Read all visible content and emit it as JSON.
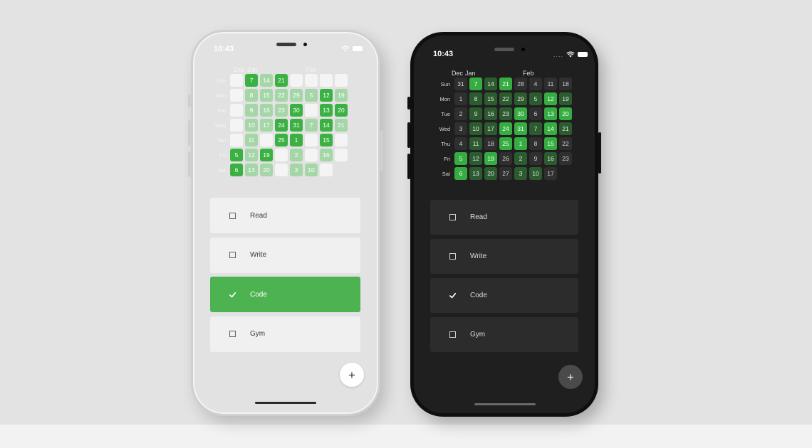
{
  "status": {
    "time": "10:43"
  },
  "calendar": {
    "months": [
      "Dec",
      "Jan",
      "Feb"
    ],
    "day_labels": [
      "Sun",
      "Mon",
      "Tue",
      "Wed",
      "Thu",
      "Fri",
      "Sat"
    ],
    "rows": [
      [
        31,
        7,
        14,
        21,
        28,
        4,
        11,
        18
      ],
      [
        1,
        8,
        15,
        22,
        29,
        5,
        12,
        19
      ],
      [
        2,
        9,
        16,
        23,
        30,
        6,
        13,
        20
      ],
      [
        3,
        10,
        17,
        24,
        31,
        7,
        14,
        21
      ],
      [
        4,
        11,
        18,
        25,
        1,
        8,
        15,
        22
      ],
      [
        5,
        12,
        19,
        26,
        2,
        9,
        16,
        23
      ],
      [
        6,
        13,
        20,
        27,
        3,
        10,
        17,
        null
      ]
    ],
    "levels": [
      [
        0,
        2,
        1,
        2,
        0,
        0,
        0,
        0
      ],
      [
        0,
        1,
        1,
        1,
        1,
        1,
        2,
        1
      ],
      [
        0,
        1,
        1,
        1,
        2,
        0,
        2,
        2
      ],
      [
        0,
        1,
        1,
        2,
        2,
        1,
        2,
        1
      ],
      [
        0,
        1,
        0,
        2,
        2,
        0,
        2,
        0
      ],
      [
        2,
        1,
        2,
        0,
        1,
        0,
        1,
        0
      ],
      [
        2,
        1,
        1,
        0,
        1,
        1,
        0,
        null
      ]
    ]
  },
  "habits": [
    {
      "label": "Read",
      "checked": false
    },
    {
      "label": "Write",
      "checked": false
    },
    {
      "label": "Code",
      "checked": true
    },
    {
      "label": "Gym",
      "checked": false
    }
  ],
  "fab": {
    "label": "+"
  },
  "colors": {
    "light_level_0": "#f4f4f4",
    "light_level_1": "#a5d6a7",
    "light_level_2": "#3bb043",
    "dark_level_0": "#2f2f2f",
    "dark_level_1": "#2c5b30",
    "dark_level_2": "#36ad41",
    "checked_row": "#4db350"
  },
  "icons": {
    "status": [
      "wifi-icon",
      "battery-icon"
    ],
    "habit_unchecked": "checkbox-icon",
    "habit_checked": "checkmark-icon",
    "fab": "plus-icon"
  }
}
